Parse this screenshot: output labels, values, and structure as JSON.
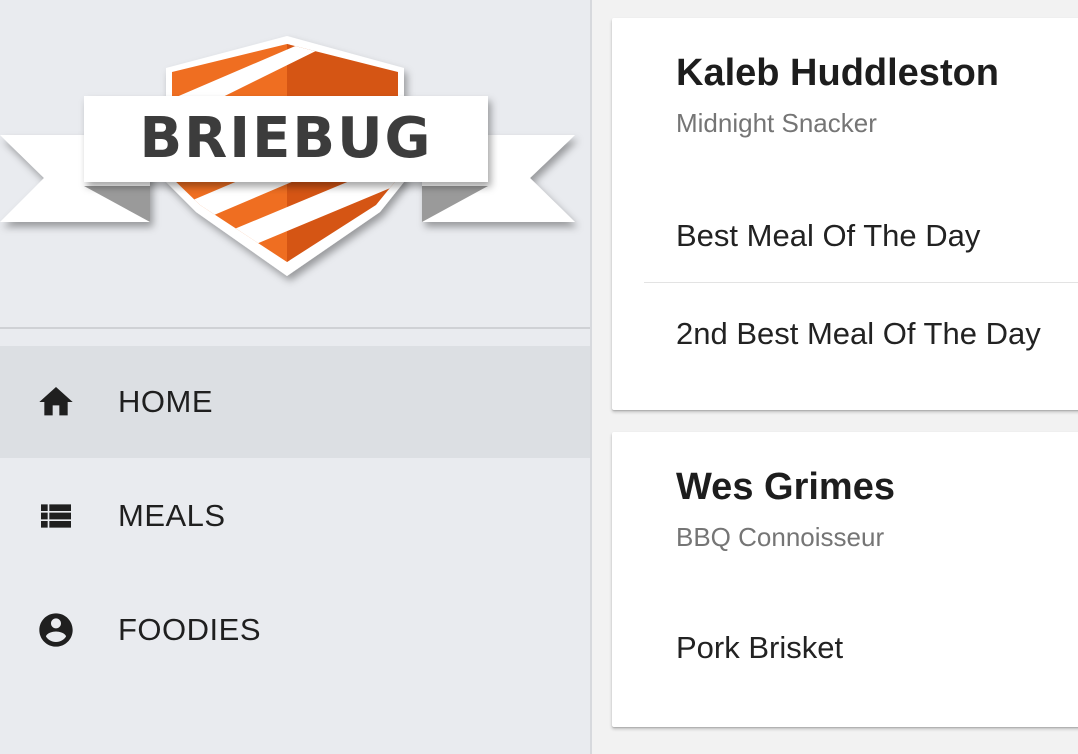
{
  "logo": {
    "text": "BRIEBUG",
    "colors": {
      "orange": "#ef6e21",
      "dark_orange": "#d55514",
      "banner": "#ffffff",
      "text": "#3c3c3c"
    }
  },
  "nav": {
    "items": [
      {
        "label": "HOME",
        "icon": "home-icon",
        "active": true
      },
      {
        "label": "MEALS",
        "icon": "list-icon",
        "active": false
      },
      {
        "label": "FOODIES",
        "icon": "account-circle-icon",
        "active": false
      }
    ]
  },
  "cards": [
    {
      "name": "Kaleb Huddleston",
      "title": "Midnight Snacker",
      "meals": [
        "Best Meal Of The Day",
        "2nd Best Meal Of The Day"
      ]
    },
    {
      "name": "Wes Grimes",
      "title": "BBQ Connoisseur",
      "meals": [
        "Pork Brisket"
      ]
    }
  ],
  "colors": {
    "sidebar_bg": "#e9ebef",
    "active_bg": "#dcdfe3",
    "main_bg": "#f2f2f2",
    "card_bg": "#ffffff"
  }
}
